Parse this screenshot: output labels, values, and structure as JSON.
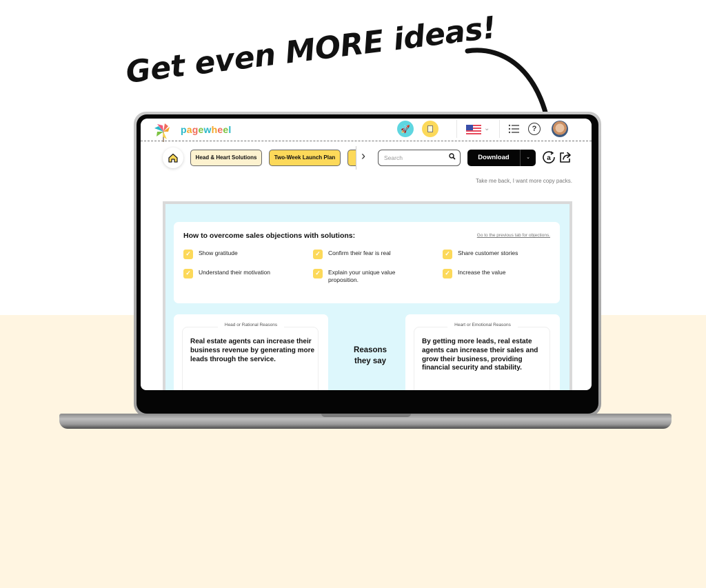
{
  "headline": "Get even MORE ideas!",
  "app": {
    "name": "pagewheel",
    "logo_letter_colors": [
      "#2bb8c8",
      "#f4a62a",
      "#f06c5b",
      "#7cc242",
      "#2bb8c8",
      "#f4a62a",
      "#f06c5b",
      "#7cc242",
      "#2bb8c8"
    ],
    "header": {
      "rocket_icon_bg": "#5fd6e0",
      "docs_icon_bg": "#fcd95a",
      "language": "US",
      "help_label": "?"
    }
  },
  "toolbar": {
    "tabs": [
      {
        "label": "Head & Heart Solutions",
        "style": "cream"
      },
      {
        "label": "Two-Week Launch Plan",
        "style": "yellow"
      },
      {
        "label": "",
        "style": "yellow"
      }
    ],
    "next_label": "›",
    "search_placeholder": "Search",
    "download_label": "Download",
    "download_caret": "⌄",
    "a_label": "a",
    "back_link": "Take me back, I want more copy packs."
  },
  "solutions": {
    "title": "How to overcome sales objections with solutions:",
    "link": "Go to the previous tab for objections.",
    "items": [
      "Show gratitude",
      "Confirm their fear is real",
      "Share customer stories",
      "Understand their motivation",
      "Explain your unique value proposition.",
      "Increase the value"
    ],
    "check_color": "#fcd95a"
  },
  "reasons": {
    "head_legend": "Head or Rational Reasons",
    "head_text": "Real estate agents can increase their business revenue by generating more leads through the service.",
    "center_label": "Reasons they say",
    "heart_legend": "Heart or Emotional Reasons",
    "heart_text": "By getting more leads, real estate agents can increase their sales and grow their business, providing financial security and stability."
  },
  "colors": {
    "cream_background": "#fff5e1",
    "content_background": "#ddf7fc",
    "accent_yellow": "#fcd95a"
  }
}
